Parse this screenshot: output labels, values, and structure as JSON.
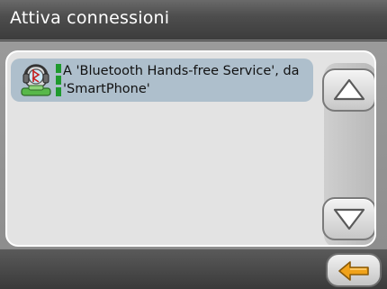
{
  "window": {
    "title": "Attiva connessioni"
  },
  "connections": [
    {
      "icon": "bluetooth-headset-icon",
      "label": "A 'Bluetooth Hands-free Service', da 'SmartPhone'",
      "selected": true
    }
  ],
  "scroll": {
    "up_icon": "arrow-up-icon",
    "down_icon": "arrow-down-icon"
  },
  "footer": {
    "back_icon": "back-arrow-icon"
  },
  "colors": {
    "row_selected": "#aebfcc",
    "status_green": "#1f9a2e",
    "back_arrow": "#f0a21a"
  }
}
